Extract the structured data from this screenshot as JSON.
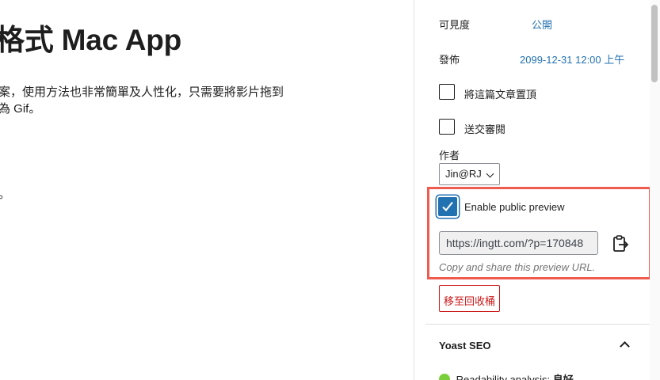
{
  "editor": {
    "title": "格式 Mac App",
    "paragraph_line1": "案，使用方法也非常簡單及人性化，只需要將影片拖到",
    "paragraph_line2": "為 Gif。",
    "paragraph_line3": "。"
  },
  "sidebar": {
    "visibility_label": "可見度",
    "visibility_value": "公開",
    "publish_label": "發佈",
    "publish_value": "2099-12-31 12:00 上午",
    "sticky_label": "將這篇文章置頂",
    "sticky_checked": false,
    "pending_label": "送交審閱",
    "pending_checked": false,
    "author_label": "作者",
    "author_value": "Jin@RJ",
    "public_preview": {
      "label": "Enable public preview",
      "checked": true,
      "url": "https://ingtt.com/?p=170848",
      "help": "Copy and share this preview URL.",
      "copy_icon": "clipboard-copy-icon"
    },
    "trash_label": "移至回收桶",
    "yoast": {
      "title": "Yoast SEO",
      "readability_label": "Readability analysis:",
      "readability_value": "良好",
      "status_color": "#7ad03a"
    }
  },
  "colors": {
    "link": "#2271b1",
    "danger": "#cc1818",
    "highlight": "#ef5b4f"
  }
}
